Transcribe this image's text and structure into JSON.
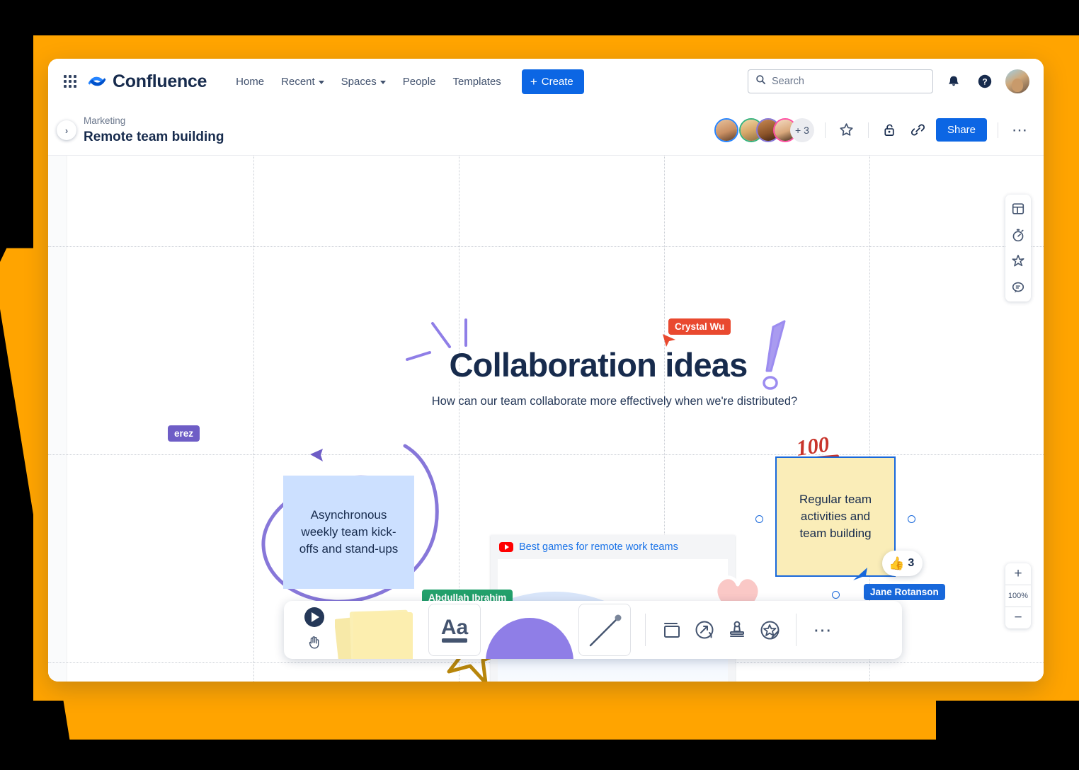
{
  "nav": {
    "app_switcher": "app-switcher",
    "brand": "Confluence",
    "links": [
      {
        "label": "Home",
        "has_caret": false
      },
      {
        "label": "Recent",
        "has_caret": true
      },
      {
        "label": "Spaces",
        "has_caret": true
      },
      {
        "label": "People",
        "has_caret": false
      },
      {
        "label": "Templates",
        "has_caret": false
      }
    ],
    "create_label": "Create",
    "search_placeholder": "Search",
    "notifications_icon": "bell-icon",
    "help_icon": "help-icon",
    "profile_icon": "profile-avatar"
  },
  "page_header": {
    "expand_icon": "chevron-right-icon",
    "space": "Marketing",
    "title": "Remote team building",
    "extra_collaborators": "+ 3",
    "star_icon": "star-icon",
    "restrictions_icon": "unlock-icon",
    "copy_link_icon": "link-icon",
    "share_label": "Share",
    "more_icon": "more-horizontal-icon",
    "avatar_rings": [
      "#2684FF",
      "#36B37E",
      "#8777D9",
      "#FF4FA3"
    ]
  },
  "whiteboard": {
    "title": "Collaboration ideas",
    "subtitle": "How can our team collaborate more effectively when we're distributed?",
    "notes": [
      {
        "text": "Asynchronous weekly team kick-offs and stand-ups",
        "color": "#CCE0FF",
        "selected": false
      },
      {
        "text": "Regular team activities and team building",
        "color": "#FAEDB8",
        "selected": true
      }
    ],
    "reaction": {
      "emoji": "thumbs-up",
      "count": "3"
    },
    "stickers": [
      {
        "name": "hundred-points-sticker",
        "label": "100"
      },
      {
        "name": "heart-sticker",
        "label": "heart"
      }
    ],
    "video": {
      "source_icon": "youtube-icon",
      "title": "Best games for remote work teams",
      "play_icon": "play-button"
    },
    "cursors": [
      {
        "name": "Crystal Wu",
        "color": "#E9492F"
      },
      {
        "name": "erez",
        "color": "#6E5DC6"
      },
      {
        "name": "Jane Rotanson",
        "color": "#1868DB"
      },
      {
        "name": "Abdullah Ibrahim",
        "color": "#22A06B"
      }
    ],
    "decorations": [
      {
        "name": "sparkle-lines",
        "color": "#8F7EE7"
      },
      {
        "name": "exclamation-mark",
        "color": "#9C8CF0"
      },
      {
        "name": "circle-scribble",
        "color": "#8777D9"
      },
      {
        "name": "star-outline",
        "color": "#B8860B"
      }
    ]
  },
  "right_rail": [
    {
      "icon": "template-icon",
      "label": "Templates"
    },
    {
      "icon": "timer-icon",
      "label": "Timer"
    },
    {
      "icon": "magic-wand-icon",
      "label": "Magic"
    },
    {
      "icon": "comment-icon",
      "label": "Comments"
    }
  ],
  "zoom_control": {
    "zoom_in": "+",
    "level": "100%",
    "zoom_out": "−"
  },
  "toolbar": {
    "items": [
      {
        "icon": "cursor-select-icon",
        "label": "Select"
      },
      {
        "icon": "hand-pan-icon",
        "label": "Pan"
      },
      {
        "icon": "sticky-notes-icon",
        "label": "Sticky note"
      },
      {
        "icon": "text-icon",
        "label": "Aa"
      },
      {
        "icon": "shape-icon",
        "label": "Shape"
      },
      {
        "icon": "line-icon",
        "label": "Line"
      },
      {
        "icon": "frame-icon",
        "label": "Frame"
      },
      {
        "icon": "flow-icon",
        "label": "Smart link"
      },
      {
        "icon": "stamp-icon",
        "label": "Stamp"
      },
      {
        "icon": "sticker-icon",
        "label": "Sticker"
      },
      {
        "icon": "more-tools-icon",
        "label": "More"
      }
    ],
    "text_tool_label": "Aa"
  }
}
